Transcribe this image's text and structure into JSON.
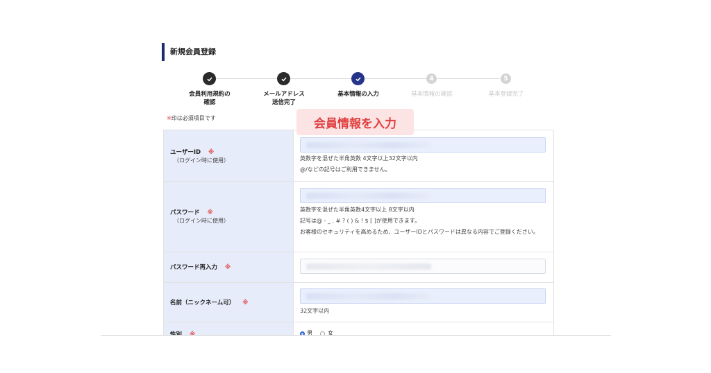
{
  "page": {
    "title": "新規会員登録"
  },
  "steps": [
    {
      "label": "会員利用規約の\n確認",
      "state": "done",
      "marker": "check-icon"
    },
    {
      "label": "メールアドレス\n送信完了",
      "state": "done",
      "marker": "check-icon"
    },
    {
      "label": "基本情報の入力",
      "state": "current",
      "marker": "check-icon"
    },
    {
      "label": "基本情報の確認",
      "state": "todo",
      "number": "4"
    },
    {
      "label": "基本登録完了",
      "state": "todo",
      "number": "5"
    }
  ],
  "required_note": {
    "mark": "※",
    "text": "印は必須項目です"
  },
  "callout": "会員情報を入力",
  "form": {
    "required_mark": "※",
    "user_id": {
      "label": "ユーザーID",
      "sub": "（ログイン時に使用）",
      "help1": "英数字を混ぜた半角英数 4文字以上32文字以内",
      "help2": "@/などの記号はご利用できません。"
    },
    "password": {
      "label": "パスワード",
      "sub": "（ログイン時に使用）",
      "help1": "英数字を混ぜた半角英数4文字以上 8文字以内",
      "help2": "記号は@ - _ . # ? ( ) & ! $ [ ]が使用できます。",
      "help3": "お客様のセキュリティを高めるため、ユーザーIDとパスワードは異なる内容でご登録ください。"
    },
    "password_confirm": {
      "label": "パスワード再入力"
    },
    "name": {
      "label": "名前（ニックネーム可）",
      "help1": "32文字以内"
    },
    "gender": {
      "label": "性別",
      "options": [
        "男",
        "女"
      ],
      "selected": "男"
    }
  },
  "colors": {
    "accent": "#26338a",
    "done": "#2b2b2b",
    "required": "#e04b4b",
    "label_bg": "#e7ecfa",
    "callout_bg": "#fde4e4",
    "callout_text": "#e04040"
  }
}
